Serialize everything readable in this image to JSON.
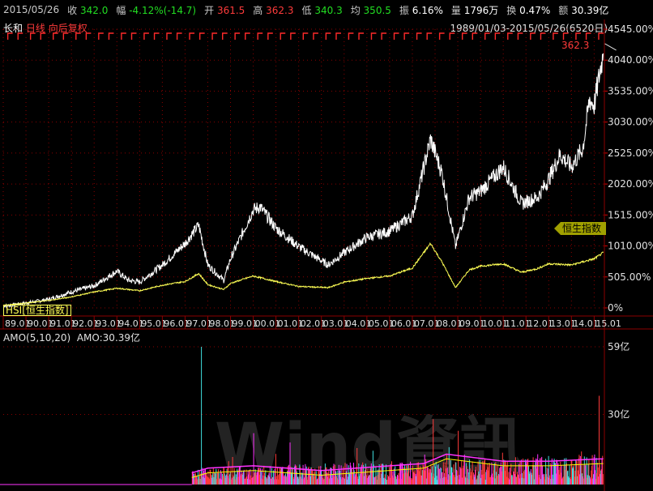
{
  "quote": {
    "date": "2015/05/26",
    "close_label": "收",
    "close": "342.0",
    "change_label": "幅",
    "change": "-4.12%(-14.7)",
    "open_label": "开",
    "open": "361.5",
    "high_label": "高",
    "high": "362.3",
    "low_label": "低",
    "low": "340.3",
    "avg_label": "均",
    "avg": "350.5",
    "amplitude_label": "振",
    "amplitude": "6.16%",
    "volume_label": "量",
    "volume": "1796万",
    "turnover_label": "换",
    "turnover": "0.47%",
    "amount_label": "额",
    "amount": "30.39亿"
  },
  "chart_header": {
    "stock": "长和",
    "period": "日线",
    "adjust": "向后复权",
    "range": "1989/01/03-2015/05/26(6520日)",
    "hsi_code": "HSI",
    "hsi_name": "恒生指数",
    "max_callout": "362.3",
    "hsi_tag": "恒生指数",
    "amo_label": "AMO(5,10,20)",
    "amo_value": "AMO:30.39亿",
    "watermark": "Wind資訊"
  },
  "colors": {
    "background": "#000000",
    "stock_line": "#ffffff",
    "hsi_line": "#ffff55",
    "up": "#ff3b3b",
    "down": "#22dd22",
    "grid": "#8b0000",
    "amo_ma5": "#ffffff",
    "amo_ma10": "#ffff00",
    "amo_ma20": "#ff33ff"
  },
  "chart_data": [
    {
      "type": "line",
      "title": "",
      "ylabel": "",
      "y_ticks": [
        "4545.00%",
        "4040.00%",
        "3535.00%",
        "3030.00%",
        "2525.00%",
        "2020.00%",
        "1515.00%",
        "1010.00%",
        "505.00%",
        "0%"
      ],
      "ylim": [
        0,
        4545
      ],
      "x_ticks": [
        "89.01",
        "90.01",
        "91.01",
        "92.01",
        "93.01",
        "94.01",
        "95.01",
        "96.01",
        "97.01",
        "98.01",
        "99.01",
        "00.01",
        "01.01",
        "02.01",
        "03.01",
        "04.01",
        "05.01",
        "06.01",
        "07.01",
        "08.01",
        "09.01",
        "10.01",
        "11.01",
        "12.01",
        "13.01",
        "14.01",
        "15.01"
      ],
      "grid": true,
      "series": [
        {
          "name": "长和",
          "x": [
            1989.0,
            1990.0,
            1991.0,
            1992.0,
            1993.0,
            1994.0,
            1994.5,
            1995.0,
            1996.0,
            1997.0,
            1997.6,
            1998.0,
            1998.7,
            1999.0,
            2000.0,
            2000.3,
            2001.0,
            2002.0,
            2003.3,
            2004.0,
            2005.0,
            2006.0,
            2007.0,
            2007.8,
            2008.3,
            2008.9,
            2009.5,
            2010.0,
            2011.0,
            2011.8,
            2012.5,
            2013.0,
            2013.5,
            2014.0,
            2014.5,
            2014.8,
            2015.0,
            2015.3,
            2015.4
          ],
          "y": [
            30,
            80,
            140,
            260,
            360,
            600,
            450,
            420,
            700,
            1050,
            1350,
            700,
            450,
            800,
            1600,
            1650,
            1300,
            1000,
            700,
            900,
            1150,
            1250,
            1500,
            2750,
            2200,
            1000,
            1800,
            1900,
            2300,
            1700,
            1800,
            2100,
            2500,
            2300,
            2600,
            3400,
            3300,
            3950,
            4150
          ]
        },
        {
          "name": "恒生指数",
          "x": [
            1989.0,
            1990.0,
            1991.0,
            1992.0,
            1993.0,
            1994.0,
            1995.0,
            1996.0,
            1997.0,
            1997.6,
            1998.0,
            1998.7,
            1999.0,
            2000.0,
            2001.0,
            2002.0,
            2003.3,
            2004.0,
            2005.0,
            2006.0,
            2007.0,
            2007.8,
            2008.3,
            2008.9,
            2009.5,
            2010.0,
            2011.0,
            2011.8,
            2012.5,
            2013.0,
            2014.0,
            2015.0,
            2015.4
          ],
          "y": [
            40,
            80,
            120,
            180,
            260,
            320,
            280,
            370,
            430,
            560,
            380,
            300,
            400,
            520,
            430,
            350,
            330,
            420,
            480,
            520,
            650,
            1050,
            750,
            330,
            620,
            680,
            720,
            580,
            640,
            720,
            700,
            800,
            900
          ]
        }
      ]
    },
    {
      "type": "bar",
      "title": "AMO(5,10,20)",
      "ylabel": "",
      "y_ticks": [
        "59亿",
        "30亿"
      ],
      "ylim": [
        0,
        59
      ],
      "unit": "亿",
      "series": [
        {
          "name": "AMO",
          "x_start": 1997.3,
          "x_end": 2015.4,
          "typical_low": 2,
          "typical_high": 12,
          "spikes": [
            {
              "x": 1997.7,
              "y": 59
            },
            {
              "x": 1998.9,
              "y": 10
            },
            {
              "x": 2000.0,
              "y": 22
            },
            {
              "x": 2001.6,
              "y": 18
            },
            {
              "x": 2007.9,
              "y": 28
            },
            {
              "x": 2009.0,
              "y": 23
            },
            {
              "x": 2015.2,
              "y": 38
            }
          ]
        },
        {
          "name": "MA5",
          "x": [
            1997.3,
            1998.0,
            2000.0,
            2003.0,
            2007.5,
            2008.5,
            2011.0,
            2013.0,
            2015.4
          ],
          "y": [
            3,
            5,
            6,
            4,
            7,
            11,
            8,
            8,
            9
          ]
        }
      ],
      "latest": "30.39亿"
    }
  ]
}
